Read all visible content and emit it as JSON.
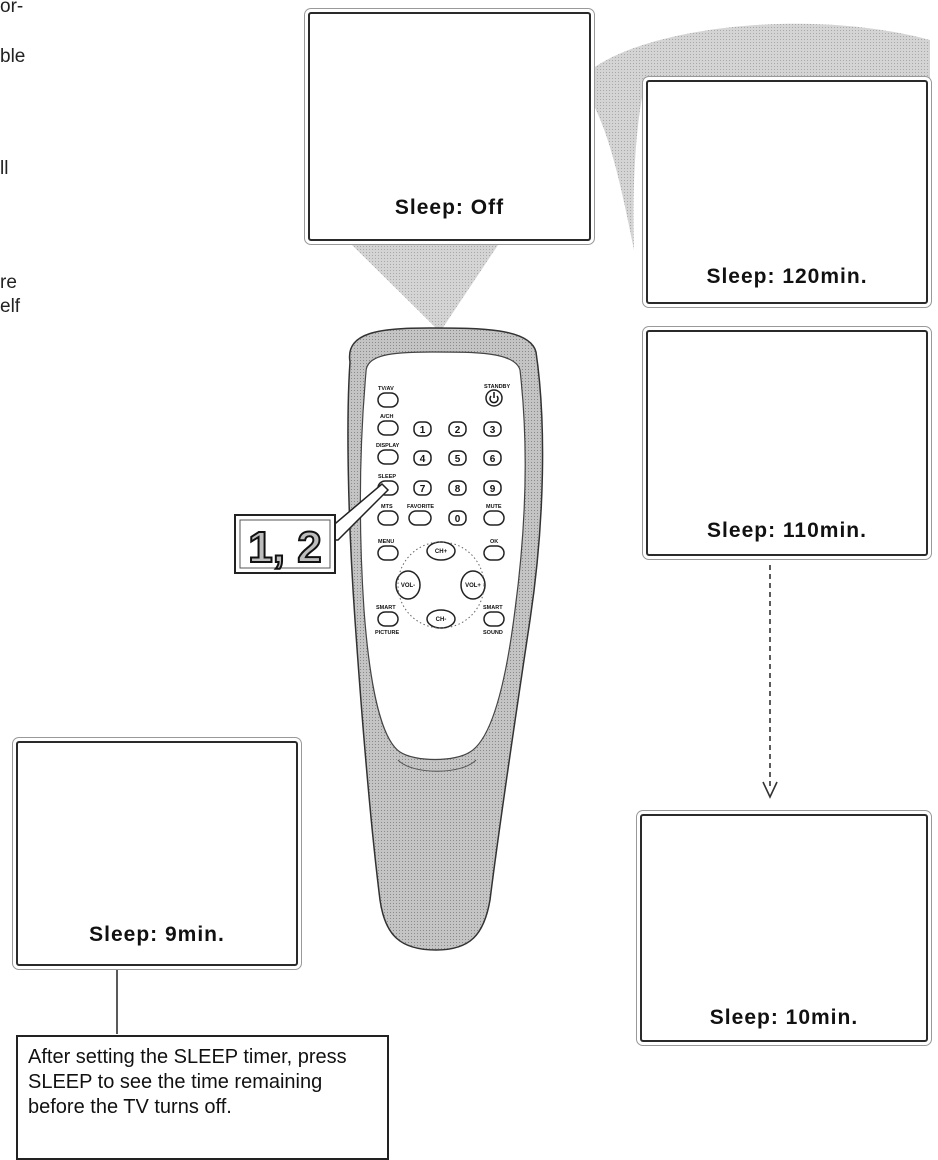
{
  "left_text_fragments": [
    "or-",
    "ble",
    "ll",
    "re",
    "elf"
  ],
  "screens": {
    "off": "Sleep: Off",
    "m120": "Sleep: 120min.",
    "m110": "Sleep: 110min.",
    "m10": "Sleep: 10min.",
    "m9": "Sleep: 9min."
  },
  "step_callout": "1, 2",
  "note_text": "After setting the SLEEP timer, press SLEEP to see the time remaining before the TV turns off.",
  "remote": {
    "tvav": "TV/AV",
    "standby": "STANDBY",
    "ach": "A/CH",
    "display": "DISPLAY",
    "sleep": "SLEEP",
    "mts": "MTS",
    "favorite": "FAVORITE",
    "mute": "MUTE",
    "menu": "MENU",
    "ok": "OK",
    "ch_up": "CH+",
    "ch_down": "CH-",
    "vol_down": "VOL-",
    "vol_up": "VOL+",
    "smart_picture_top": "SMART",
    "smart_picture_bottom": "PICTURE",
    "smart_sound_top": "SMART",
    "smart_sound_bottom": "SOUND",
    "digits": [
      "1",
      "2",
      "3",
      "4",
      "5",
      "6",
      "7",
      "8",
      "9",
      "0"
    ]
  }
}
